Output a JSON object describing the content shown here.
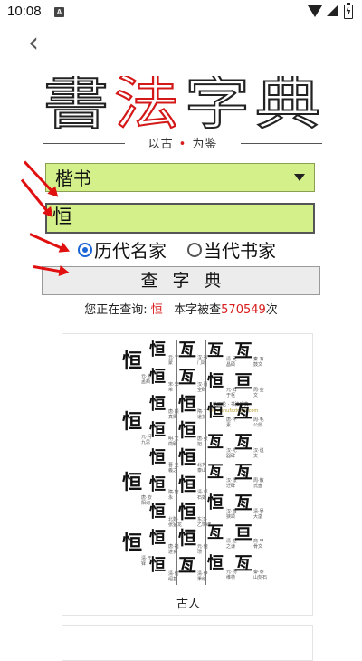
{
  "status_bar": {
    "time": "10:08",
    "notification_badge": "A",
    "battery_glyph": "ϟ"
  },
  "header": {
    "back_icon": "‹",
    "logo_chars": [
      "書",
      "法",
      "字",
      "典"
    ],
    "slogan_left": "以古",
    "slogan_dot": "•",
    "slogan_right": "为鉴"
  },
  "form": {
    "script_select": {
      "value": "楷书"
    },
    "char_input": {
      "value": "恒"
    },
    "radio_options": [
      {
        "label": "历代名家",
        "checked": true
      },
      {
        "label": "当代书家",
        "checked": false
      }
    ],
    "search_button_label": "查字典"
  },
  "query_status": {
    "prefix": "您正在查询:",
    "char": "恒",
    "middle": "本字被查",
    "count": "570549",
    "suffix": "次"
  },
  "result_card": {
    "label": "古人",
    "watermark_line1": "第四轮 · 书法字典",
    "watermark_line2": "www.shufazidian.com",
    "columns": [
      {
        "glyphs": [
          {
            "char": "恒",
            "caption": "元·赵孟頫"
          },
          {
            "char": "恒",
            "caption": "元·柯九思"
          },
          {
            "char": "恒",
            "caption": "唐·欧阳询"
          },
          {
            "char": "恒",
            "caption": "清·王铎"
          }
        ]
      },
      {
        "glyphs": [
          {
            "char": "恒",
            "caption": "元·王蒙"
          },
          {
            "char": "恒",
            "caption": "宋·米芾"
          },
          {
            "char": "恒",
            "caption": "唐·颜真卿"
          },
          {
            "char": "恒",
            "caption": "明·文徵明"
          },
          {
            "char": "恒",
            "caption": "晋·王羲之"
          },
          {
            "char": "恒",
            "caption": "隋·智永"
          },
          {
            "char": "恒",
            "caption": "北魏·张猛龙"
          },
          {
            "char": "恒",
            "caption": "唐·褚遂良"
          },
          {
            "char": "恒",
            "caption": "清·何绍基"
          }
        ]
      },
      {
        "glyphs": [
          {
            "char": "亙",
            "caption": "汉·石门颂"
          },
          {
            "char": "亙",
            "caption": "汉·曹全碑"
          },
          {
            "char": "恒",
            "caption": "隋·丁道护"
          },
          {
            "char": "恒",
            "caption": "唐·张旭"
          },
          {
            "char": "恒",
            "caption": "北齐·泰山"
          },
          {
            "char": "恒",
            "caption": "清·邓石如"
          },
          {
            "char": "恒",
            "caption": "东汉·乙瑛碑"
          },
          {
            "char": "恒",
            "caption": "元·倪瓒"
          },
          {
            "char": "亙",
            "caption": "清·伊秉绶"
          }
        ]
      },
      {
        "glyphs": [
          {
            "char": "亙",
            "caption": "清·吴昌硕"
          },
          {
            "char": "恒",
            "caption": "元·鲜于枢"
          },
          {
            "char": "恒",
            "caption": "唐·怀素"
          },
          {
            "char": "亙",
            "caption": "汉·礼器碑"
          },
          {
            "char": "亙",
            "caption": "汉·张迁碑"
          },
          {
            "char": "恒",
            "caption": "汉·西狭颂"
          },
          {
            "char": "亙",
            "caption": "清·赵之谦"
          },
          {
            "char": "恒",
            "caption": "元·杨维桢"
          }
        ]
      },
      {
        "glyphs": [
          {
            "char": "亙",
            "caption": "秦·石鼓文"
          },
          {
            "char": "亘",
            "caption": "周·金文"
          },
          {
            "char": "亙",
            "caption": "周·毛公鼎"
          },
          {
            "char": "亙",
            "caption": "汉·说文"
          },
          {
            "char": "亙",
            "caption": "周·散氏盘"
          },
          {
            "char": "亙",
            "caption": "清·吴大澂"
          },
          {
            "char": "亘",
            "caption": "商·甲骨文"
          },
          {
            "char": "亙",
            "caption": "秦·泰山刻石"
          }
        ]
      }
    ]
  },
  "arrows": [
    {
      "target": "script_select"
    },
    {
      "target": "char_input"
    },
    {
      "target": "radio_historical"
    },
    {
      "target": "search_button"
    }
  ]
}
